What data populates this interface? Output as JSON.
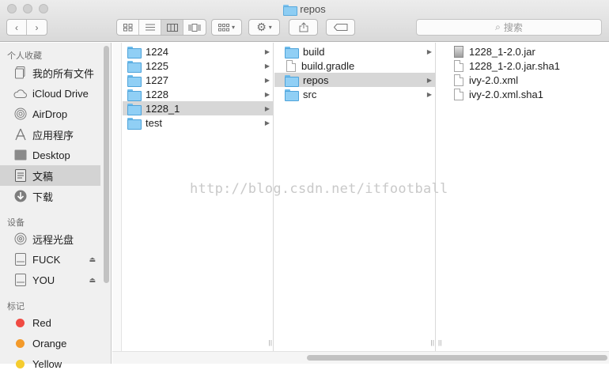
{
  "window": {
    "title": "repos"
  },
  "search": {
    "placeholder": "搜索"
  },
  "sidebar": {
    "favorites_heading": "个人收藏",
    "favorites": [
      {
        "label": "我的所有文件",
        "icon": "all-files-icon"
      },
      {
        "label": "iCloud Drive",
        "icon": "cloud-icon"
      },
      {
        "label": "AirDrop",
        "icon": "airdrop-icon"
      },
      {
        "label": "应用程序",
        "icon": "applications-icon"
      },
      {
        "label": "Desktop",
        "icon": "desktop-icon"
      },
      {
        "label": "文稿",
        "icon": "documents-icon"
      },
      {
        "label": "下载",
        "icon": "downloads-icon"
      }
    ],
    "devices_heading": "设备",
    "devices": [
      {
        "label": "远程光盘",
        "icon": "disc-icon"
      },
      {
        "label": "FUCK",
        "icon": "drive-icon"
      },
      {
        "label": "YOU",
        "icon": "drive-icon"
      }
    ],
    "tags_heading": "标记",
    "tags": [
      {
        "label": "Red",
        "color": "#f04b43"
      },
      {
        "label": "Orange",
        "color": "#f39a2a"
      },
      {
        "label": "Yellow",
        "color": "#f5cc2f"
      }
    ]
  },
  "columns": [
    {
      "items": [
        {
          "label": "1224",
          "type": "folder"
        },
        {
          "label": "1225",
          "type": "folder"
        },
        {
          "label": "1227",
          "type": "folder"
        },
        {
          "label": "1228",
          "type": "folder"
        },
        {
          "label": "1228_1",
          "type": "folder",
          "selected": true
        },
        {
          "label": "test",
          "type": "folder"
        }
      ]
    },
    {
      "items": [
        {
          "label": "build",
          "type": "folder"
        },
        {
          "label": "build.gradle",
          "type": "file"
        },
        {
          "label": "repos",
          "type": "folder",
          "selected": true
        },
        {
          "label": "src",
          "type": "folder"
        }
      ]
    },
    {
      "items": [
        {
          "label": "1228_1-2.0.jar",
          "type": "jar"
        },
        {
          "label": "1228_1-2.0.jar.sha1",
          "type": "file"
        },
        {
          "label": "ivy-2.0.xml",
          "type": "file"
        },
        {
          "label": "ivy-2.0.xml.sha1",
          "type": "file"
        }
      ]
    }
  ],
  "watermark": "http://blog.csdn.net/itfootball"
}
